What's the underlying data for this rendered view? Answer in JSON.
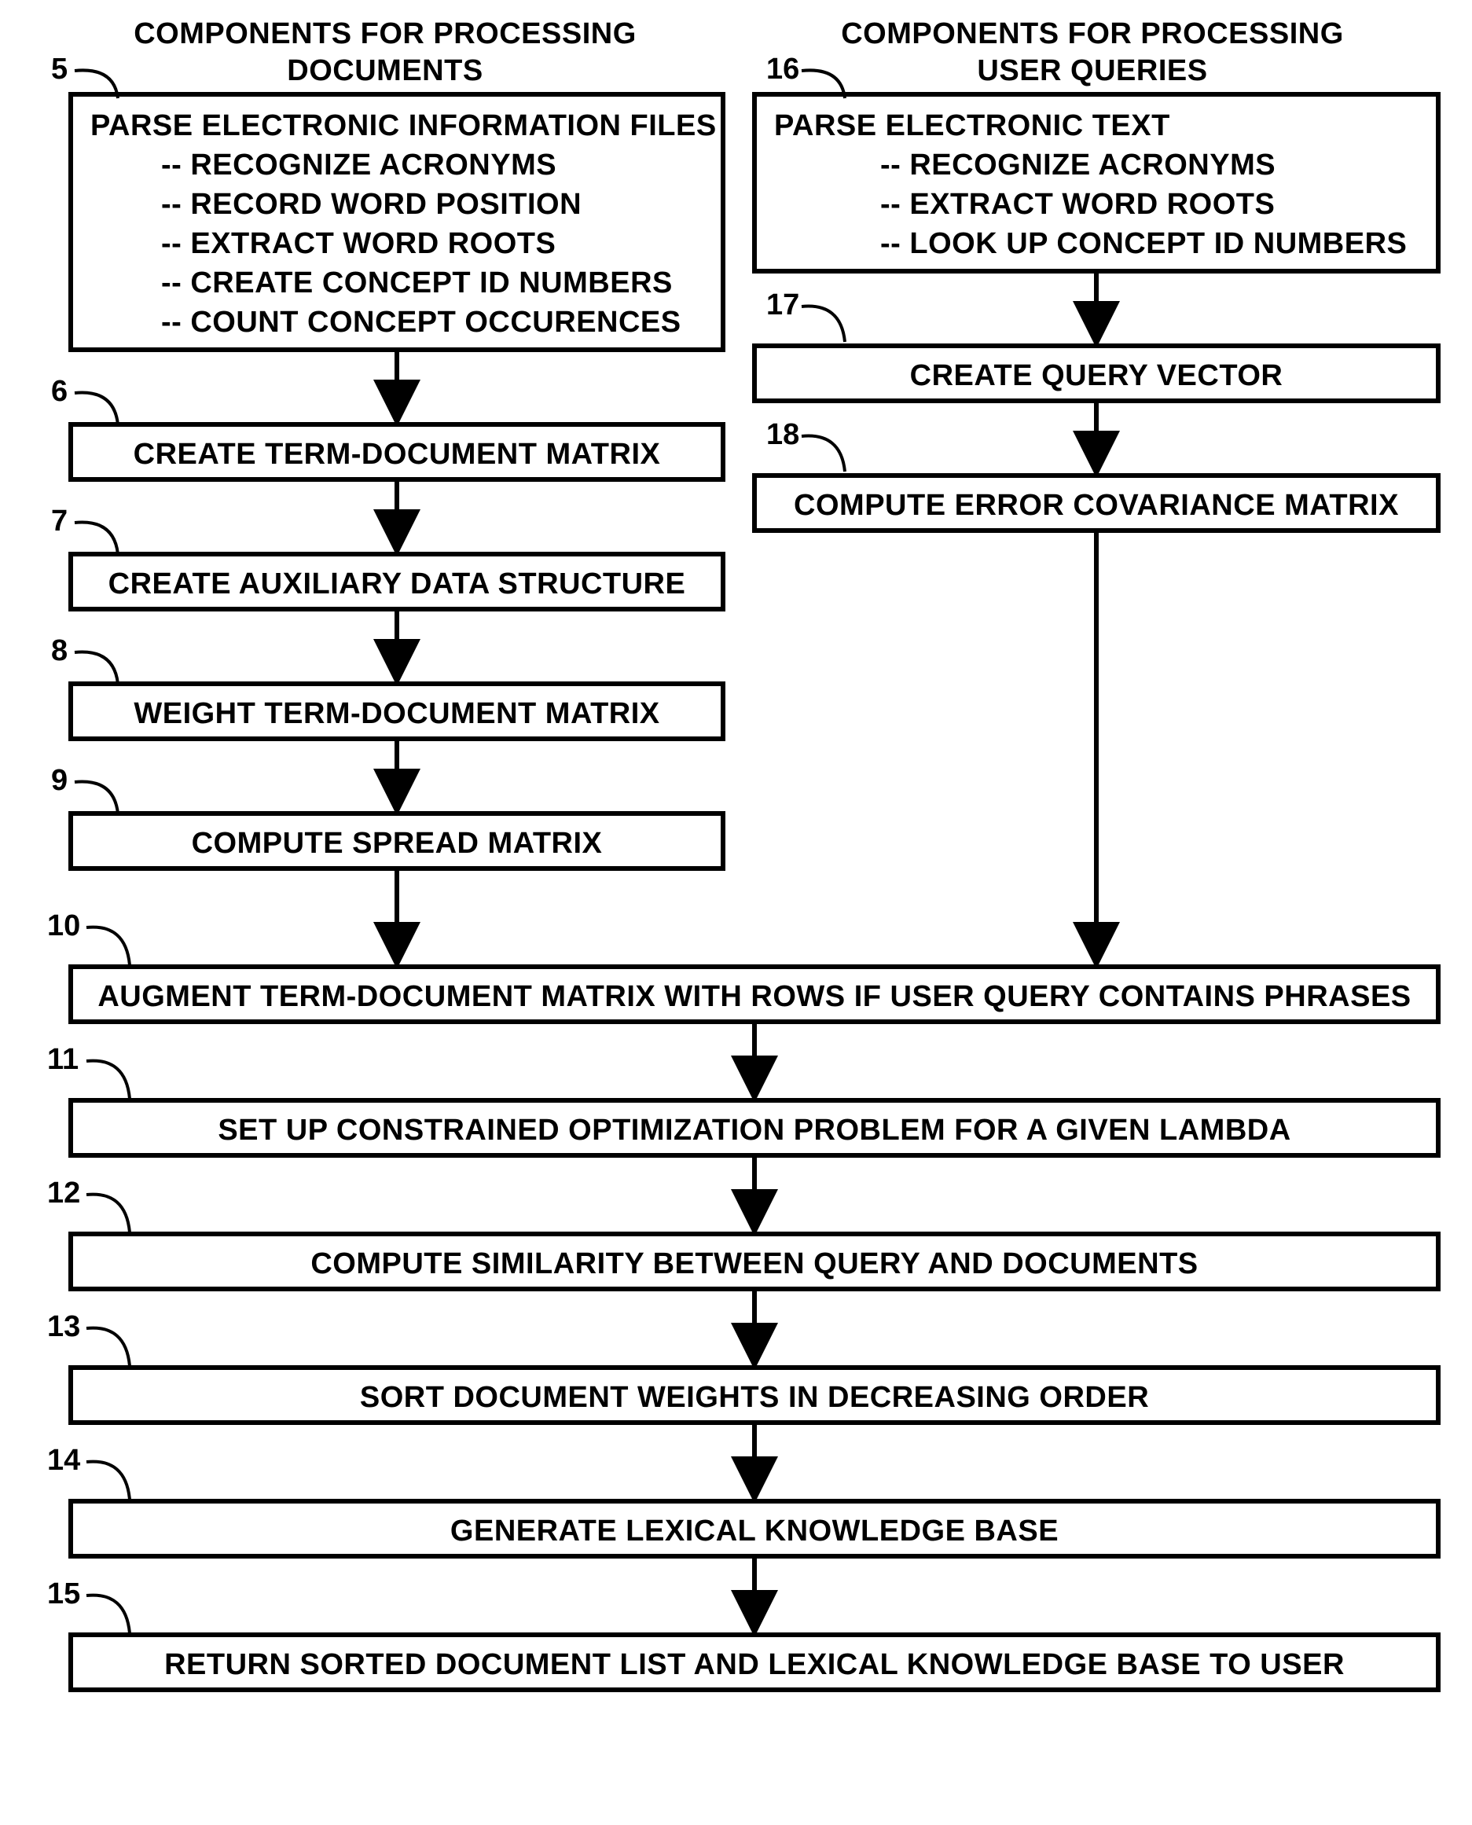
{
  "left_title1": "COMPONENTS FOR PROCESSING",
  "left_title2": "DOCUMENTS",
  "right_title1": "COMPONENTS FOR PROCESSING",
  "right_title2": "USER QUERIES",
  "ref5": "5",
  "ref6": "6",
  "ref7": "7",
  "ref8": "8",
  "ref9": "9",
  "ref10": "10",
  "ref11": "11",
  "ref12": "12",
  "ref13": "13",
  "ref14": "14",
  "ref15": "15",
  "ref16": "16",
  "ref17": "17",
  "ref18": "18",
  "box5_title": "PARSE ELECTRONIC INFORMATION FILES",
  "box5_items": [
    "-- RECOGNIZE ACRONYMS",
    "-- RECORD WORD POSITION",
    "-- EXTRACT WORD ROOTS",
    "-- CREATE CONCEPT ID NUMBERS",
    "-- COUNT CONCEPT OCCURENCES"
  ],
  "box6": "CREATE TERM-DOCUMENT MATRIX",
  "box7": "CREATE AUXILIARY DATA STRUCTURE",
  "box8": "WEIGHT TERM-DOCUMENT MATRIX",
  "box9": "COMPUTE SPREAD MATRIX",
  "box16_title": "PARSE ELECTRONIC TEXT",
  "box16_items": [
    "-- RECOGNIZE ACRONYMS",
    "-- EXTRACT WORD ROOTS",
    "-- LOOK UP CONCEPT ID NUMBERS"
  ],
  "box17": "CREATE QUERY VECTOR",
  "box18": "COMPUTE ERROR COVARIANCE MATRIX",
  "box10": "AUGMENT TERM-DOCUMENT MATRIX WITH ROWS IF USER QUERY CONTAINS PHRASES",
  "box11": "SET UP CONSTRAINED OPTIMIZATION PROBLEM FOR A GIVEN LAMBDA",
  "box12": "COMPUTE SIMILARITY BETWEEN QUERY AND DOCUMENTS",
  "box13": "SORT DOCUMENT WEIGHTS IN DECREASING ORDER",
  "box14": "GENERATE LEXICAL KNOWLEDGE BASE",
  "box15": "RETURN SORTED DOCUMENT LIST AND LEXICAL KNOWLEDGE BASE TO USER"
}
